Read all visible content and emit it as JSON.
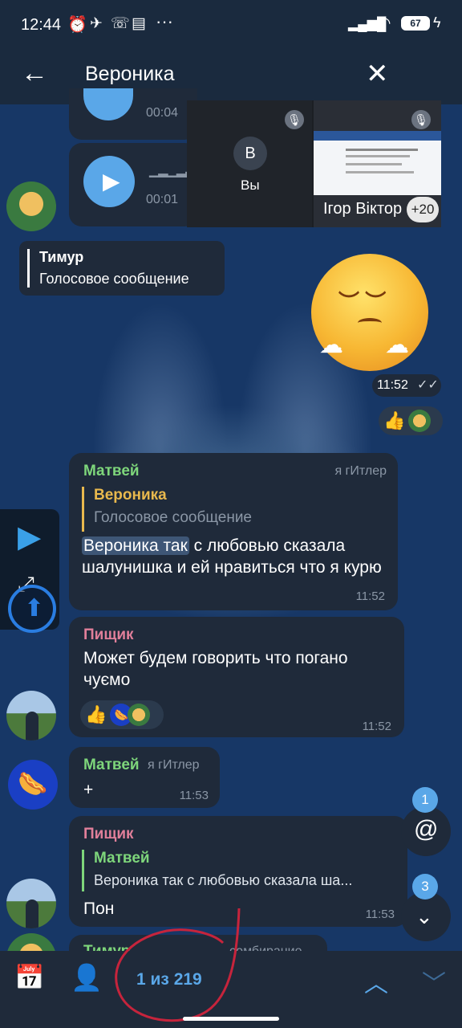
{
  "status_bar": {
    "time": "12:44",
    "battery": "67"
  },
  "header": {
    "title": "Вероника"
  },
  "call_overlay": {
    "me_initial": "В",
    "me_label": "Вы",
    "other_name": "Ігор Віктор",
    "extra_count": "+20"
  },
  "voice_msgs": [
    {
      "duration": "00:04"
    },
    {
      "duration": "00:01"
    }
  ],
  "reply_card": {
    "name": "Тимур",
    "text": "Голосовое сообщение"
  },
  "sticker_time": "11:52",
  "messages": [
    {
      "name": "Матвей",
      "tag": "я гИтлер",
      "quote_name": "Вероника",
      "quote_text": "Голосовое сообщение",
      "highlight": "Вероника так",
      "text_rest": " с любовью сказала шалунишка и ей нравиться что я курю",
      "time": "11:52"
    },
    {
      "name": "Пищик",
      "text": "Может будем говорить что погано чуємо",
      "time": "11:52"
    },
    {
      "name": "Матвей",
      "tag": "я гИтлер",
      "text": "+",
      "time": "11:53"
    },
    {
      "name": "Пищик",
      "quote_name": "Матвей",
      "quote_text": "Вероника так с любовью сказала ша...",
      "text": "Пон",
      "time": "11:53"
    },
    {
      "name": "Тимур",
      "tag": "сомбирание"
    }
  ],
  "badges": {
    "mentions": "1",
    "unread": "3"
  },
  "bottom_bar": {
    "counter": "1 из 219"
  },
  "colors": {
    "accent": "#5aa7e8",
    "matvey": "#7ed67b",
    "pishchik": "#e07f9a",
    "veronika": "#e8b84d"
  }
}
